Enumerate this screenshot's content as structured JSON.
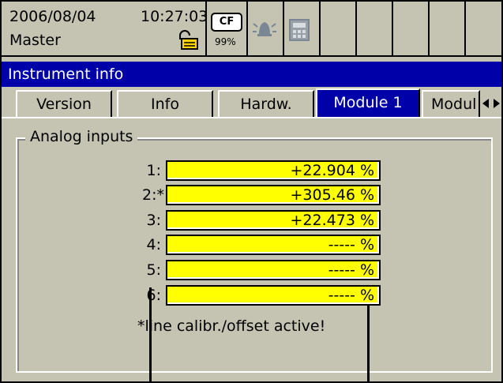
{
  "status": {
    "date": "2006/08/04",
    "time": "10:27:03",
    "user": "Master",
    "cf_label": "CF",
    "cf_percent": "99%"
  },
  "icons": {
    "lock": "lock-icon",
    "cf": "cf-card-icon",
    "alarm": "bell-icon",
    "calc": "calculator-icon"
  },
  "window": {
    "title": "Instrument info"
  },
  "tabs": [
    {
      "label": "Version"
    },
    {
      "label": "Info"
    },
    {
      "label": "Hardw."
    },
    {
      "label": "Module 1",
      "active": true
    },
    {
      "label": "Modul"
    }
  ],
  "group": {
    "title": "Analog inputs",
    "rows": [
      {
        "label": "1:",
        "value": "+22.904 %"
      },
      {
        "label": "2:*",
        "value": "+305.46 %"
      },
      {
        "label": "3:",
        "value": "+22.473 %"
      },
      {
        "label": "4:",
        "value": "----- %"
      },
      {
        "label": "5:",
        "value": "----- %"
      },
      {
        "label": "6:",
        "value": "----- %"
      }
    ],
    "footnote": "*line calibr./offset active!"
  },
  "colors": {
    "background": "#c5c3b2",
    "title_bar": "#0000a8",
    "value_field": "#ffff00"
  }
}
